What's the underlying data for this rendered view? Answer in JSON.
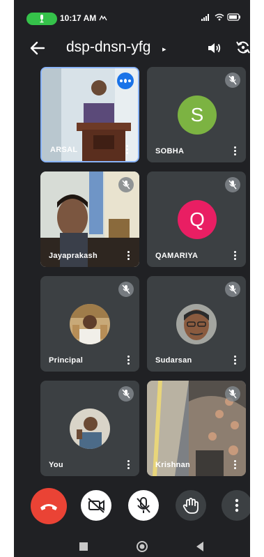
{
  "status_bar": {
    "time": "10:17 AM",
    "icons": "VoLTE wifi battery"
  },
  "header": {
    "meeting_code": "dsp-dnsn-yfg"
  },
  "participants": [
    {
      "name": "ARSAL",
      "type": "video",
      "speaking": true
    },
    {
      "name": "SOBHA",
      "type": "letter",
      "letter": "S",
      "color": "#7cb342",
      "muted": true
    },
    {
      "name": "Jayaprakash",
      "type": "video",
      "muted": true
    },
    {
      "name": "QAMARIYA",
      "type": "letter",
      "letter": "Q",
      "color": "#e91e63",
      "muted": true
    },
    {
      "name": "Principal",
      "type": "photo",
      "muted": true
    },
    {
      "name": "Sudarsan",
      "type": "photo",
      "muted": true
    },
    {
      "name": "You",
      "type": "photo",
      "muted": true
    },
    {
      "name": "Krishnan",
      "type": "video",
      "muted": true
    }
  ],
  "controls": {
    "end_call_color": "#ea4335",
    "items": [
      "end-call",
      "camera-off",
      "mic-off",
      "raise-hand",
      "more-options"
    ]
  },
  "nav": {
    "items": [
      "recents",
      "home",
      "back"
    ]
  }
}
